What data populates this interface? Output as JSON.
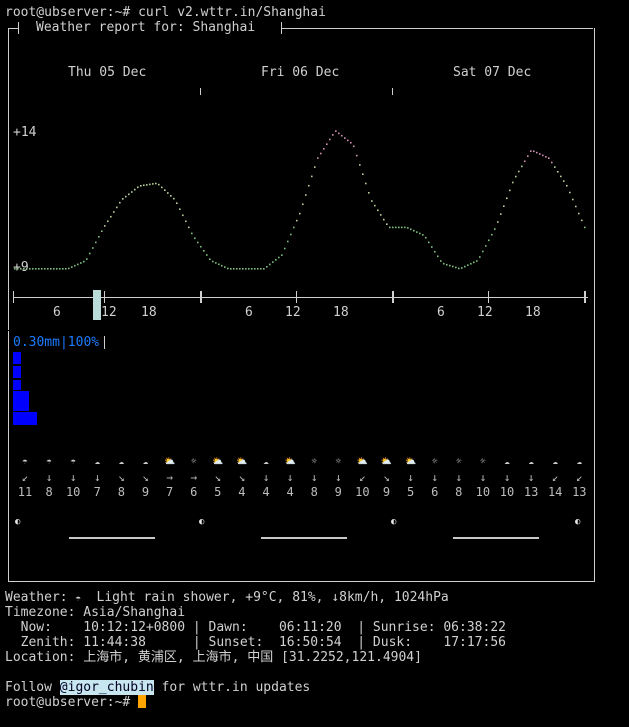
{
  "prompt": "root@ubserver:~#",
  "command": "curl v2.wttr.in/Shanghai",
  "report_title": "Weather report for: Shanghai",
  "days": [
    "Thu 05 Dec",
    "Fri 06 Dec",
    "Sat 07 Dec"
  ],
  "temp_max_label": "+14",
  "temp_min_label": "+9",
  "hour_labels": [
    "6",
    "12",
    "18",
    "6",
    "12",
    "18",
    "6",
    "12",
    "18"
  ],
  "precip_label": "0.30mm|100%",
  "colors": {
    "precip": "#1a7cff",
    "precip_bar": "#0000ff",
    "cursor": "#ffa500",
    "curve_cool": "#7fbf7f",
    "curve_warm": "#d28fb4"
  },
  "weather_icons": [
    "rain-shower-icon",
    "rain-shower-icon",
    "rain-shower-icon",
    "cloud-icon",
    "cloud-icon",
    "cloud-icon",
    "partly-cloudy-icon",
    "sun-icon",
    "partly-cloudy-icon",
    "partly-cloudy-icon",
    "cloud-icon",
    "partly-cloudy-icon",
    "sun-icon",
    "sun-icon",
    "partly-cloudy-icon",
    "partly-cloudy-icon",
    "partly-cloudy-icon",
    "sun-icon",
    "sun-icon",
    "sun-icon",
    "cloud-icon",
    "cloud-icon",
    "cloud-icon",
    "cloud-icon"
  ],
  "wind_dirs": [
    "↙",
    "↓",
    "↓",
    "↓",
    "↘",
    "↘",
    "→",
    "→",
    "↘",
    "↘",
    "↓",
    "↓",
    "↓",
    "↓",
    "↙",
    "↘",
    "↓",
    "↓",
    "↓",
    "↓",
    "↓",
    "↓",
    "↙",
    "↙"
  ],
  "wind_speeds": [
    "11",
    "8",
    "10",
    "7",
    "8",
    "9",
    "7",
    "6",
    "5",
    "4",
    "4",
    "4",
    "8",
    "9",
    "10",
    "9",
    "5",
    "6",
    "8",
    "10",
    "10",
    "13",
    "14",
    "13"
  ],
  "summary": {
    "weather_label": "Weather:",
    "weather_text": "Light rain shower, +9°C, 81%, ↓8km/h, 1024hPa",
    "timezone_label": "Timezone:",
    "timezone": "Asia/Shanghai",
    "now_label": "Now:",
    "now": "10:12:12+0800",
    "dawn_label": "Dawn:",
    "dawn": "06:11:20",
    "sunrise_label": "Sunrise:",
    "sunrise": "06:38:22",
    "zenith_label": "Zenith:",
    "zenith": "11:44:38",
    "sunset_label": "Sunset:",
    "sunset": "16:50:54",
    "dusk_label": "Dusk:",
    "dusk": "17:17:56",
    "location_label": "Location:",
    "location": "上海市, 黄浦区, 上海市, 中国 [31.2252,121.4904]"
  },
  "follow_prefix": "Follow",
  "follow_handle": "@igor_chubin",
  "follow_suffix": "for wttr.in updates",
  "temperature_curve": [
    9,
    9,
    9,
    9,
    9.3,
    10.5,
    11.5,
    12,
    12.1,
    11.5,
    10.2,
    9.3,
    9,
    9,
    9,
    9.5,
    11,
    13,
    14,
    13.5,
    11.5,
    10.5,
    10.5,
    10.2,
    9.2,
    9,
    9.3,
    10.5,
    12.2,
    13.3,
    13,
    12,
    10.5
  ]
}
